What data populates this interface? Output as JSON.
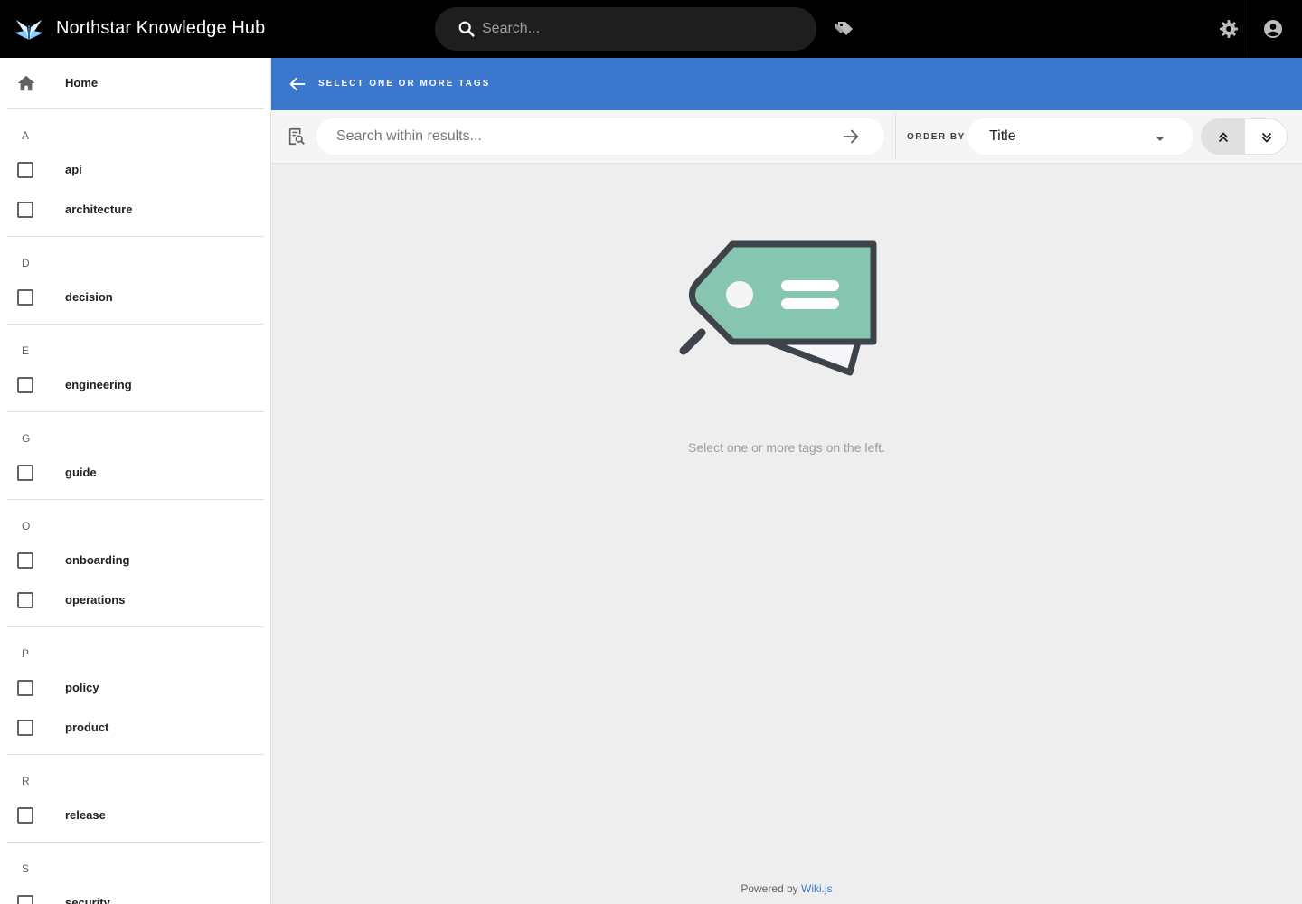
{
  "app": {
    "title": "Northstar Knowledge Hub"
  },
  "search": {
    "placeholder": "Search..."
  },
  "sidebar": {
    "home_label": "Home",
    "groups": [
      {
        "letter": "A",
        "tags": [
          "api",
          "architecture"
        ]
      },
      {
        "letter": "D",
        "tags": [
          "decision"
        ]
      },
      {
        "letter": "E",
        "tags": [
          "engineering"
        ]
      },
      {
        "letter": "G",
        "tags": [
          "guide"
        ]
      },
      {
        "letter": "O",
        "tags": [
          "onboarding",
          "operations"
        ]
      },
      {
        "letter": "P",
        "tags": [
          "policy",
          "product"
        ]
      },
      {
        "letter": "R",
        "tags": [
          "release"
        ]
      },
      {
        "letter": "S",
        "tags": [
          "security"
        ]
      }
    ]
  },
  "header": {
    "title": "SELECT ONE OR MORE TAGS"
  },
  "toolbar": {
    "results_placeholder": "Search within results...",
    "order_label": "ORDER BY",
    "order_value": "Title"
  },
  "empty_state": {
    "message": "Select one or more tags on the left."
  },
  "footer": {
    "prefix": "Powered by ",
    "link": "Wiki.js"
  },
  "colors": {
    "accent": "#3a77cd",
    "tag_fill": "#86c6b0",
    "tag_stroke": "#3d4349"
  },
  "icons": {
    "logo": "wiki-logo-icon",
    "search": "search-icon",
    "tags": "tags-icon",
    "settings": "gear-icon",
    "account": "account-circle-icon",
    "home": "home-icon",
    "back": "arrow-left-icon",
    "filter": "search-in-page-icon",
    "go": "arrow-right-icon",
    "sort_asc": "chevron-double-up-icon",
    "sort_desc": "chevron-double-down-icon"
  }
}
